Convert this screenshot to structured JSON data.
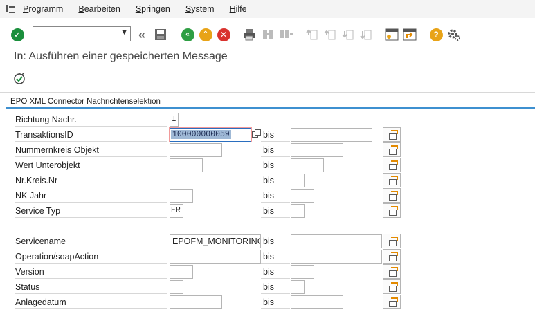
{
  "menu": {
    "items": [
      "Programm",
      "Bearbeiten",
      "Springen",
      "System",
      "Hilfe"
    ]
  },
  "toolbar": {
    "command_value": ""
  },
  "page": {
    "title": "In: Ausführen einer gespeicherten Message"
  },
  "section": {
    "title": "EPO XML Connector Nachrichtenselektion",
    "bis_label": "bis",
    "rows": [
      {
        "label": "Richtung Nachr.",
        "value": "I"
      },
      {
        "label": "TransaktionsID",
        "value": "100000000059",
        "to": ""
      },
      {
        "label": "Nummernkreis Objekt",
        "value": "",
        "to": ""
      },
      {
        "label": "Wert Unterobjekt",
        "value": "",
        "to": ""
      },
      {
        "label": "Nr.Kreis.Nr",
        "value": "",
        "to": ""
      },
      {
        "label": "NK Jahr",
        "value": "",
        "to": ""
      },
      {
        "label": "Service Typ",
        "value": "ER",
        "to": ""
      },
      {
        "label": "Servicename",
        "value": "EPOFM_MONITORING",
        "to": ""
      },
      {
        "label": "Operation/soapAction",
        "value": "",
        "to": ""
      },
      {
        "label": "Version",
        "value": "",
        "to": ""
      },
      {
        "label": "Status",
        "value": "",
        "to": ""
      },
      {
        "label": "Anlagedatum",
        "value": "",
        "to": ""
      }
    ]
  },
  "colors": {
    "accent_blue": "#3e90d0",
    "ok_green": "#1a8f3c",
    "back_green": "#2e9e43",
    "exit_yellow": "#e8a317",
    "cancel_red": "#d9322e",
    "help_yellow": "#e8a317"
  }
}
